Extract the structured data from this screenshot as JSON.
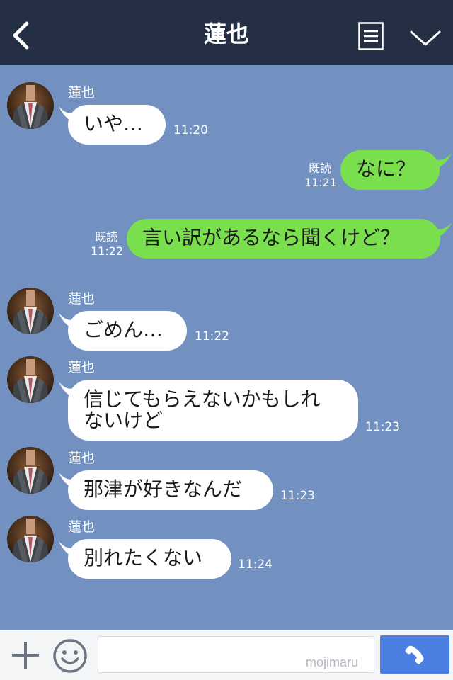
{
  "header": {
    "title": "蓮也"
  },
  "messages": [
    {
      "sender": "蓮也",
      "text": "いや…",
      "time": "11:20"
    },
    {
      "read": "既読",
      "time": "11:21",
      "text": "なに？"
    },
    {
      "read": "既読",
      "time": "11:22",
      "text": "言い訳があるなら聞くけど？"
    },
    {
      "sender": "蓮也",
      "text": "ごめん…",
      "time": "11:22"
    },
    {
      "sender": "蓮也",
      "line1": "信じてもらえないかもしれ",
      "line2": "ないけど",
      "time": "11:23"
    },
    {
      "sender": "蓮也",
      "text": "那津が好きなんだ",
      "time": "11:23"
    },
    {
      "sender": "蓮也",
      "text": "別れたくない",
      "time": "11:24"
    }
  ],
  "input": {
    "watermark": "mojimaru"
  },
  "colors": {
    "header_bg": "#252f44",
    "chat_bg": "#7291c1",
    "outgoing_bubble": "#79df4c",
    "incoming_bubble": "#ffffff",
    "call_button": "#4c7fe2"
  },
  "icons": [
    "back-arrow-icon",
    "menu-list-icon",
    "chevron-down-icon",
    "plus-icon",
    "smile-icon",
    "phone-icon"
  ]
}
